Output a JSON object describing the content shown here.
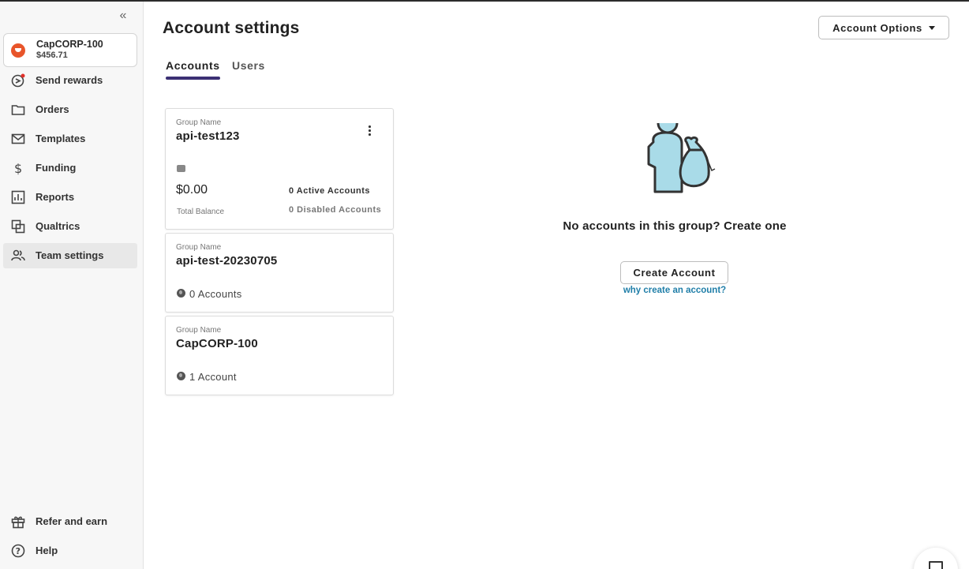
{
  "sidebar": {
    "account": {
      "name": "CapCORP-100",
      "balance": "$456.71"
    },
    "items": [
      {
        "label": "Send rewards",
        "icon": "send-rewards-icon"
      },
      {
        "label": "Orders",
        "icon": "folder-icon"
      },
      {
        "label": "Templates",
        "icon": "mail-icon"
      },
      {
        "label": "Funding",
        "icon": "dollar-icon"
      },
      {
        "label": "Reports",
        "icon": "bar-chart-icon"
      },
      {
        "label": "Qualtrics",
        "icon": "copy-icon"
      },
      {
        "label": "Team settings",
        "icon": "team-icon",
        "active": true
      }
    ],
    "bottom": [
      {
        "label": "Refer and earn",
        "icon": "gift-icon"
      },
      {
        "label": "Help",
        "icon": "help-icon"
      }
    ]
  },
  "header": {
    "title": "Account settings",
    "options_button": "Account Options"
  },
  "tabs": [
    {
      "label": "Accounts",
      "active": true
    },
    {
      "label": "Users",
      "active": false
    }
  ],
  "groups": [
    {
      "label": "Group Name",
      "name": "api-test123",
      "balance": "$0.00",
      "balance_label": "Total Balance",
      "active_accounts": "0 Active Accounts",
      "disabled_accounts": "0 Disabled Accounts"
    },
    {
      "label": "Group Name",
      "name": "api-test-20230705",
      "accounts": "0 Accounts"
    },
    {
      "label": "Group Name",
      "name": "CapCORP-100",
      "accounts": "1 Account"
    }
  ],
  "empty_state": {
    "message": "No accounts in this group? Create one",
    "create_button": "Create Account",
    "why_link": "why create an account?"
  },
  "colors": {
    "tab_underline": "#3b3074",
    "link": "#1f7ea8",
    "brand_logo": "#e8552a",
    "illustration_fill": "#a9dbe8"
  }
}
